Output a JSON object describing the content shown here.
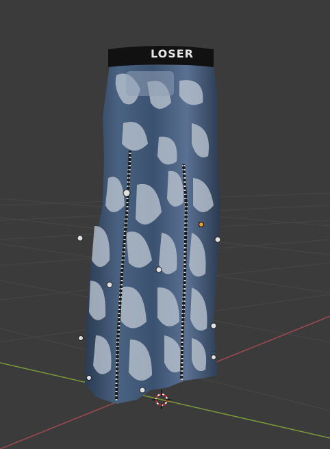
{
  "viewport": {
    "background": "#3b3b3b",
    "grid_color": "#474747",
    "x_axis_color": "#a14a52",
    "y_axis_color": "#7a9a3a"
  },
  "model": {
    "name_icon": "jeans-model",
    "waistband_text": "LOSER",
    "denim_dark": "#33465f",
    "denim_light": "#b9c3cf",
    "waistband_color": "#111111"
  },
  "cursor": {
    "icon": "3d-cursor-icon"
  },
  "origin_marker": {
    "icon": "object-origin-dot-icon",
    "color": "#f0a020"
  }
}
